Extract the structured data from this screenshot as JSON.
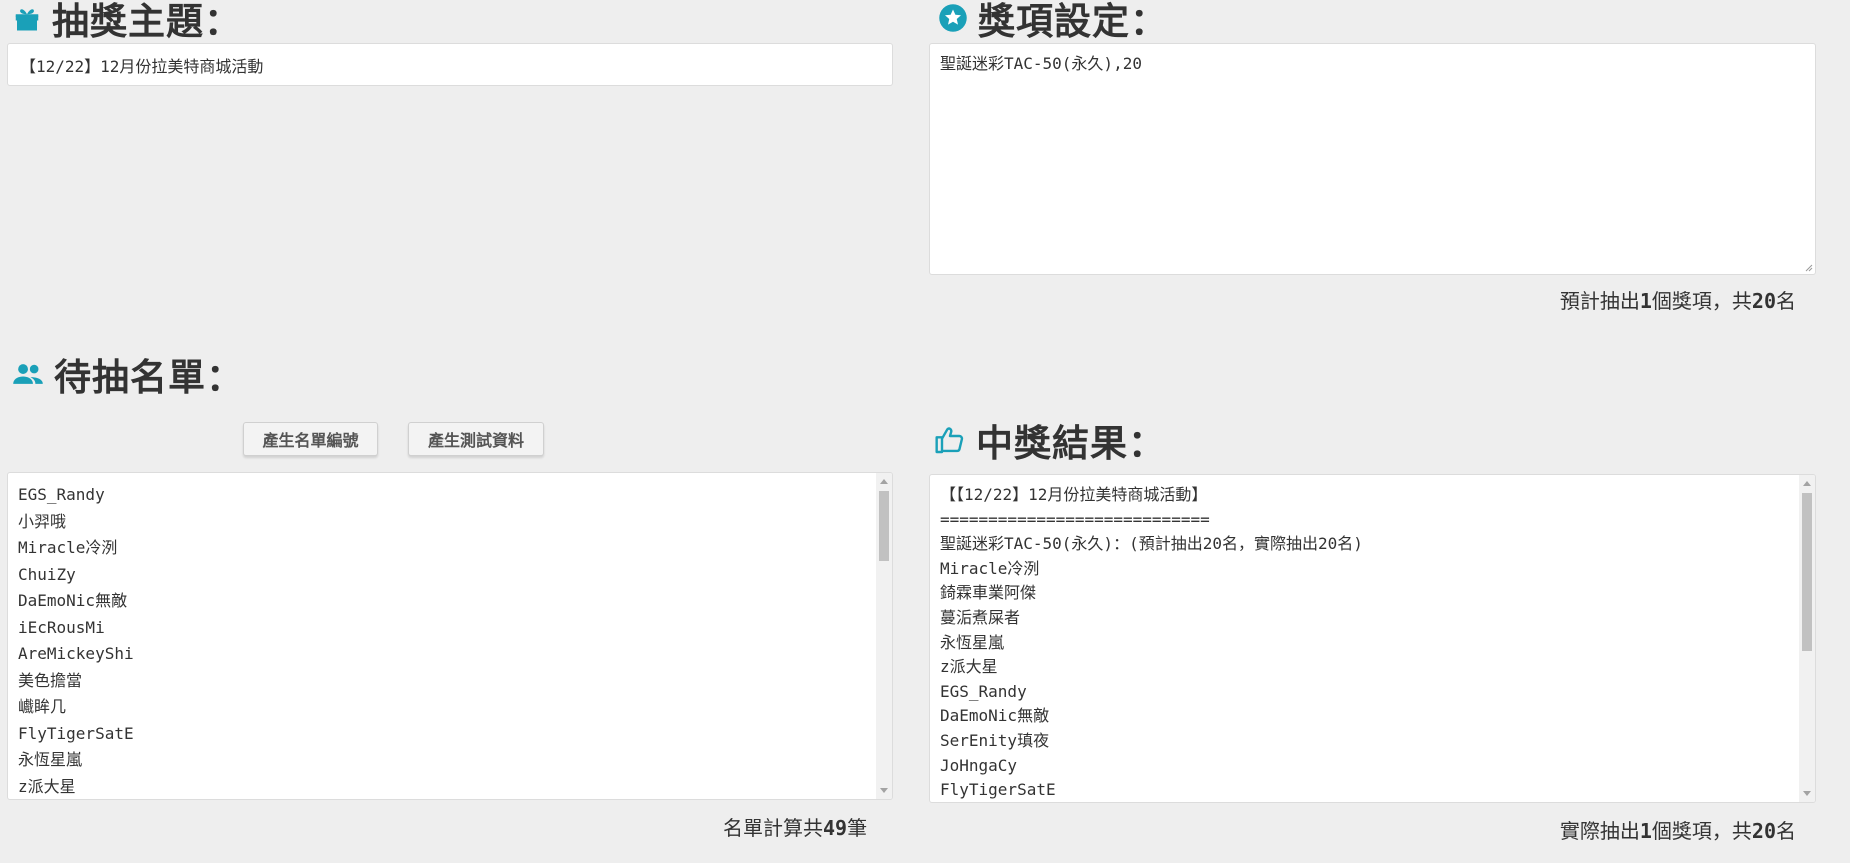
{
  "colors": {
    "accent": "#1aa0b8",
    "background": "#eeeeee"
  },
  "topic": {
    "title": "抽獎主題：",
    "icon": "gift-icon",
    "value": "【12/22】12月份拉美特商城活動"
  },
  "prizes": {
    "title": "獎項設定：",
    "icon": "star-icon",
    "value": "聖誕迷彩TAC-50(永久),20",
    "summary": {
      "prefix": "預計抽出",
      "count": "1",
      "mid": "個獎項，共",
      "total": "20",
      "suffix": "名"
    }
  },
  "candidates": {
    "title": "待抽名單：",
    "icon": "users-icon",
    "number_button": "產生名單編號",
    "test_data_button": "產生測試資料",
    "items": [
      "EGS_Randy",
      "小羿哦",
      "Miracle冷洌",
      "ChuiZy",
      "DaEmoNic無敵",
      "iEcRousMi",
      "AreMickeyShi",
      "美色擔當",
      "巇眸几",
      "FlyTigerSatE",
      "永恆星嵐",
      "z派大星"
    ],
    "summary": {
      "prefix": "名單計算共",
      "count": "49",
      "suffix": "筆"
    }
  },
  "results": {
    "title": "中獎結果：",
    "icon": "thumbs-up-icon",
    "lines": [
      "【【12/22】12月份拉美特商城活動】",
      "============================",
      "聖誕迷彩TAC-50(永久)：(預計抽出20名，實際抽出20名)",
      "Miracle冷洌",
      "錡霖車業阿傑",
      "蔓洉煮屎者",
      "永恆星嵐",
      "z派大星",
      "EGS_Randy",
      "DaEmoNic無敵",
      "SerEnity瑱夜",
      "JoHngaCy",
      "FlyTigerSatE"
    ],
    "summary": {
      "prefix": "實際抽出",
      "count": "1",
      "mid": "個獎項，共",
      "total": "20",
      "suffix": "名"
    }
  }
}
